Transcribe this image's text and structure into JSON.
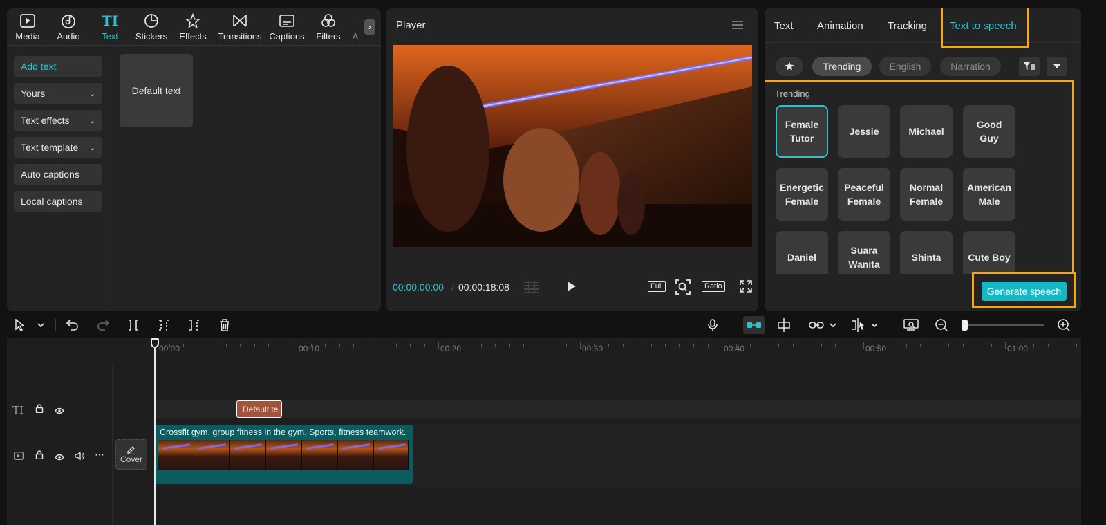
{
  "media_tabs": [
    {
      "label": "Media",
      "icon": "media-icon"
    },
    {
      "label": "Audio",
      "icon": "audio-icon"
    },
    {
      "label": "Text",
      "icon": "text-icon",
      "active": true
    },
    {
      "label": "Stickers",
      "icon": "sticker-icon"
    },
    {
      "label": "Effects",
      "icon": "effects-icon"
    },
    {
      "label": "Transitions",
      "icon": "transitions-icon"
    },
    {
      "label": "Captions",
      "icon": "captions-icon"
    },
    {
      "label": "Filters",
      "icon": "filters-icon"
    },
    {
      "label": "A",
      "icon": "adjust-icon"
    }
  ],
  "text_menu": {
    "add_text": "Add text",
    "yours": "Yours",
    "text_effects": "Text effects",
    "text_template": "Text template",
    "auto_captions": "Auto captions",
    "local_captions": "Local captions"
  },
  "default_text_card": "Default text",
  "player": {
    "title": "Player",
    "current_time": "00:00:00:00",
    "separator": "/",
    "total_time": "00:00:18:08",
    "full_label": "Full",
    "ratio_label": "Ratio"
  },
  "right_tabs": {
    "text": "Text",
    "animation": "Animation",
    "tracking": "Tracking",
    "tts": "Text to speech"
  },
  "filters": {
    "trending": "Trending",
    "english": "English",
    "narration": "Narration"
  },
  "voices_section_title": "Trending",
  "voices": [
    [
      "Female",
      "Tutor"
    ],
    [
      "Jessie"
    ],
    [
      "Michael"
    ],
    [
      "Good",
      "Guy"
    ],
    [
      "Energetic",
      "Female"
    ],
    [
      "Peaceful",
      "Female"
    ],
    [
      "Normal",
      "Female"
    ],
    [
      "American",
      "Male"
    ],
    [
      "Daniel"
    ],
    [
      "Suara",
      "Wanita"
    ],
    [
      "Shinta"
    ],
    [
      "Cute Boy"
    ]
  ],
  "generate_button": "Generate speech",
  "ruler": [
    "00:00",
    "00:10",
    "00:20",
    "00:30",
    "00:40",
    "00:50",
    "01:00"
  ],
  "timeline": {
    "text_clip": "Default te",
    "video_clip": "Crossfit gym. group fitness in the gym. Sports, fitness teamwork.",
    "cover_label": "Cover"
  },
  "colors": {
    "accent": "#2bc3cf",
    "highlight": "#f2a819",
    "text_clip": "#a1533c",
    "video_clip": "#0c5b5e"
  }
}
